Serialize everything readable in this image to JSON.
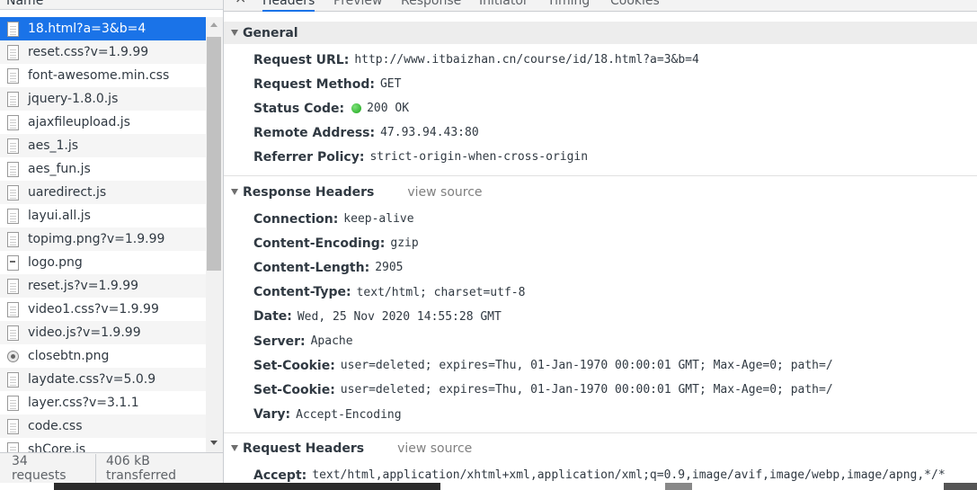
{
  "left_pane": {
    "header": "Name",
    "files": [
      {
        "name": "18.html?a=3&b=4",
        "icon": "document-icon",
        "selected": true
      },
      {
        "name": "reset.css?v=1.9.99",
        "icon": "document-icon"
      },
      {
        "name": "font-awesome.min.css",
        "icon": "document-icon"
      },
      {
        "name": "jquery-1.8.0.js",
        "icon": "document-icon"
      },
      {
        "name": "ajaxfileupload.js",
        "icon": "document-icon"
      },
      {
        "name": "aes_1.js",
        "icon": "document-icon"
      },
      {
        "name": "aes_fun.js",
        "icon": "document-icon"
      },
      {
        "name": "uaredirect.js",
        "icon": "document-icon"
      },
      {
        "name": "layui.all.js",
        "icon": "document-icon"
      },
      {
        "name": "topimg.png?v=1.9.99",
        "icon": "document-icon"
      },
      {
        "name": "logo.png",
        "icon": "image-icon"
      },
      {
        "name": "reset.js?v=1.9.99",
        "icon": "document-icon"
      },
      {
        "name": "video1.css?v=1.9.99",
        "icon": "document-icon"
      },
      {
        "name": "video.js?v=1.9.99",
        "icon": "document-icon"
      },
      {
        "name": "closebtn.png",
        "icon": "round-image-icon"
      },
      {
        "name": "laydate.css?v=5.0.9",
        "icon": "document-icon"
      },
      {
        "name": "layer.css?v=3.1.1",
        "icon": "document-icon"
      },
      {
        "name": "code.css",
        "icon": "document-icon"
      },
      {
        "name": "shCore.js",
        "icon": "document-icon"
      }
    ],
    "status": {
      "requests": "34 requests",
      "transferred": "406 kB transferred"
    }
  },
  "tabs": [
    "Headers",
    "Preview",
    "Response",
    "Initiator",
    "Timing",
    "Cookies"
  ],
  "active_tab": "Headers",
  "general": {
    "title": "General",
    "rows": [
      {
        "key": "Request URL:",
        "value": "http://www.itbaizhan.cn/course/id/18.html?a=3&b=4"
      },
      {
        "key": "Request Method:",
        "value": "GET"
      },
      {
        "key": "Status Code:",
        "value": "200 OK",
        "status_dot": true
      },
      {
        "key": "Remote Address:",
        "value": "47.93.94.43:80"
      },
      {
        "key": "Referrer Policy:",
        "value": "strict-origin-when-cross-origin"
      }
    ]
  },
  "response_headers": {
    "title": "Response Headers",
    "view_source": "view source",
    "rows": [
      {
        "key": "Connection:",
        "value": "keep-alive"
      },
      {
        "key": "Content-Encoding:",
        "value": "gzip"
      },
      {
        "key": "Content-Length:",
        "value": "2905"
      },
      {
        "key": "Content-Type:",
        "value": "text/html; charset=utf-8"
      },
      {
        "key": "Date:",
        "value": "Wed, 25 Nov 2020 14:55:28 GMT"
      },
      {
        "key": "Server:",
        "value": "Apache"
      },
      {
        "key": "Set-Cookie:",
        "value": "user=deleted; expires=Thu, 01-Jan-1970 00:00:01 GMT; Max-Age=0; path=/"
      },
      {
        "key": "Set-Cookie:",
        "value": "user=deleted; expires=Thu, 01-Jan-1970 00:00:01 GMT; Max-Age=0; path=/"
      },
      {
        "key": "Vary:",
        "value": "Accept-Encoding"
      }
    ]
  },
  "request_headers": {
    "title": "Request Headers",
    "view_source": "view source",
    "rows": [
      {
        "key": "Accept:",
        "value": "text/html,application/xhtml+xml,application/xml;q=0.9,image/avif,image/webp,image/apng,*/*"
      }
    ]
  },
  "colors": {
    "selected_row": "#1a73e8",
    "status_ok": "#1aa51a"
  }
}
